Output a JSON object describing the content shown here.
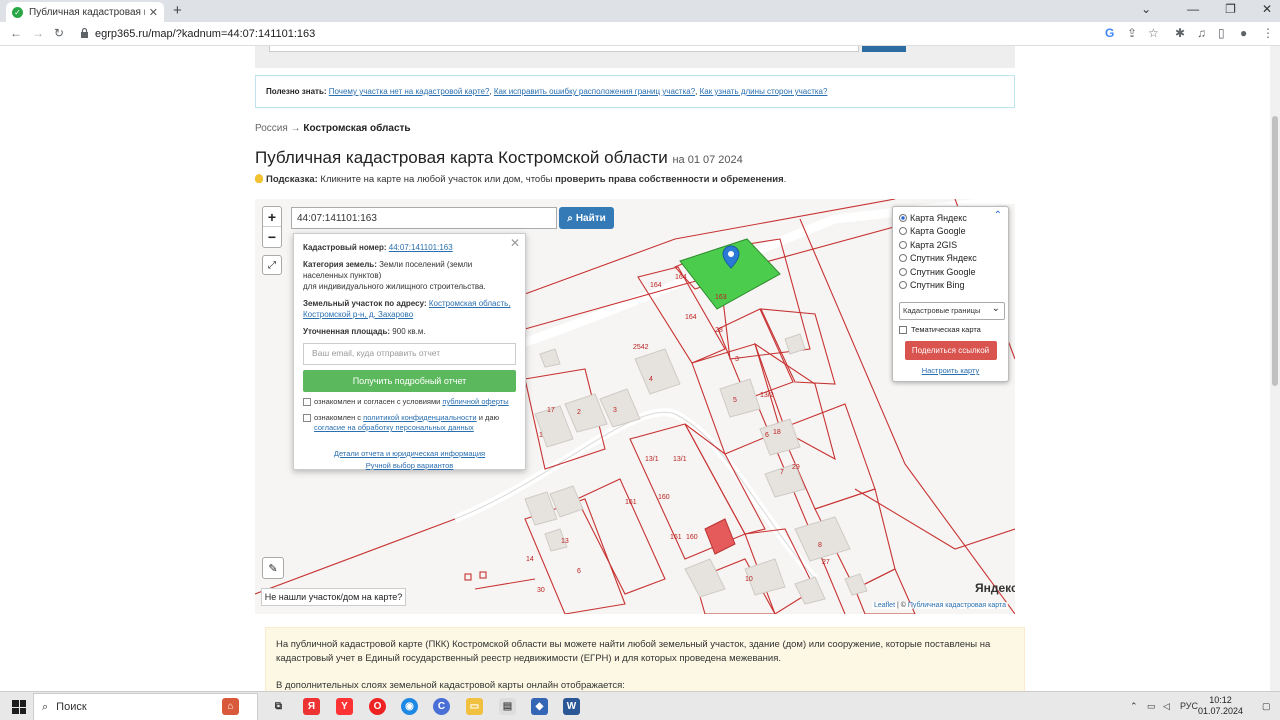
{
  "browser": {
    "tab_title": "Публичная кадастровая карта К",
    "url": "egrp365.ru/map/?kadnum=44:07:141101:163"
  },
  "tip": {
    "label": "Полезно знать:",
    "links": [
      "Почему участка нет на кадастровой карте?",
      "Как исправить ошибку расположения границ участка?",
      "Как узнать длины сторон участка?"
    ]
  },
  "breadcrumb": {
    "root": "Россия",
    "arrow": "→",
    "current": "Костромская область"
  },
  "page_title": "Публичная кадастровая карта Костромской области",
  "page_date": "на 01 07 2024",
  "hint": {
    "label": "Подсказка:",
    "text": "Кликните на карте на любой участок или дом, чтобы",
    "bold": "проверить права собственности и обременения",
    "end": "."
  },
  "map": {
    "search_value": "44:07:141101:163",
    "find_label": "Найти",
    "zoom_in": "+",
    "zoom_out": "−",
    "not_found": "Не нашли участок/дом на карте?",
    "yandex": "Яндекс",
    "attrib_leaflet": "Leaflet",
    "attrib_sep": "| ©",
    "attrib_pkk": "Публичная кадастровая карта",
    "parcel_labels": [
      "163",
      "164",
      "164",
      "164",
      "28",
      "3",
      "2542",
      "4",
      "5",
      "13/2",
      "6",
      "18",
      "7",
      "29",
      "8",
      "27",
      "17",
      "2",
      "3",
      "1",
      "13/1",
      "13/1",
      "160",
      "161",
      "160",
      "161",
      "13",
      "14",
      "6",
      "30",
      "10",
      "2",
      "3"
    ]
  },
  "popup": {
    "cad_label": "Кадастровый номер:",
    "cad_value": "44:07:141101:163",
    "cat_label": "Категория земель:",
    "cat_value": "Земли поселений (земли населенных пунктов)",
    "cat_use": "для индивидуального жилищного строительства.",
    "addr_label": "Земельный участок по адресу:",
    "addr_value": "Костромская область, Костромской р-н, д. Захарово",
    "area_label": "Уточненная площадь:",
    "area_value": "900 кв.м.",
    "email_placeholder": "Ваш email, куда отправить отчет",
    "report_btn": "Получить подробный отчет",
    "chk1_a": "ознакомлен и согласен с условиями",
    "chk1_link": "публичной оферты",
    "chk2_a": "ознакомлен с",
    "chk2_link": "политикой конфиденциальности",
    "chk2_b": "и даю",
    "chk2_link2": "согласие на обработку персональных данных",
    "details_link": "Детали отчета и юридическая информация",
    "manual_link": "Ручной выбор вариантов"
  },
  "layers": {
    "options": [
      "Карта Яндекс",
      "Карта Google",
      "Карта 2GIS",
      "Спутник Яндекс",
      "Спутник Google",
      "Спутник Bing"
    ],
    "selected": "Карта Яндекс",
    "overlay_select": "Кадастровые границы",
    "thematic": "Тематическая карта",
    "share": "Поделиться ссылкой",
    "configure": "Настроить карту"
  },
  "info": {
    "p1": "На публичной кадастровой карте (ПКК) Костромской области вы можете найти любой земельный участок, здание (дом) или сооружение, которые поставлены на кадастровый учет в Единый государственный реестр недвижимости (ЕГРН) и для которых проведена межевания.",
    "p2": "В дополнительных слоях земельной кадастровой карты онлайн отображается:"
  },
  "taskbar": {
    "search": "Поиск",
    "lang": "РУС",
    "time": "10:12",
    "date": "01.07.2024"
  },
  "colors": {
    "accent": "#337ab7",
    "parcel_line": "#c83232",
    "selected_parcel": "#4ccc4c",
    "report_btn": "#5cb85c",
    "share_btn": "#d9534f"
  }
}
